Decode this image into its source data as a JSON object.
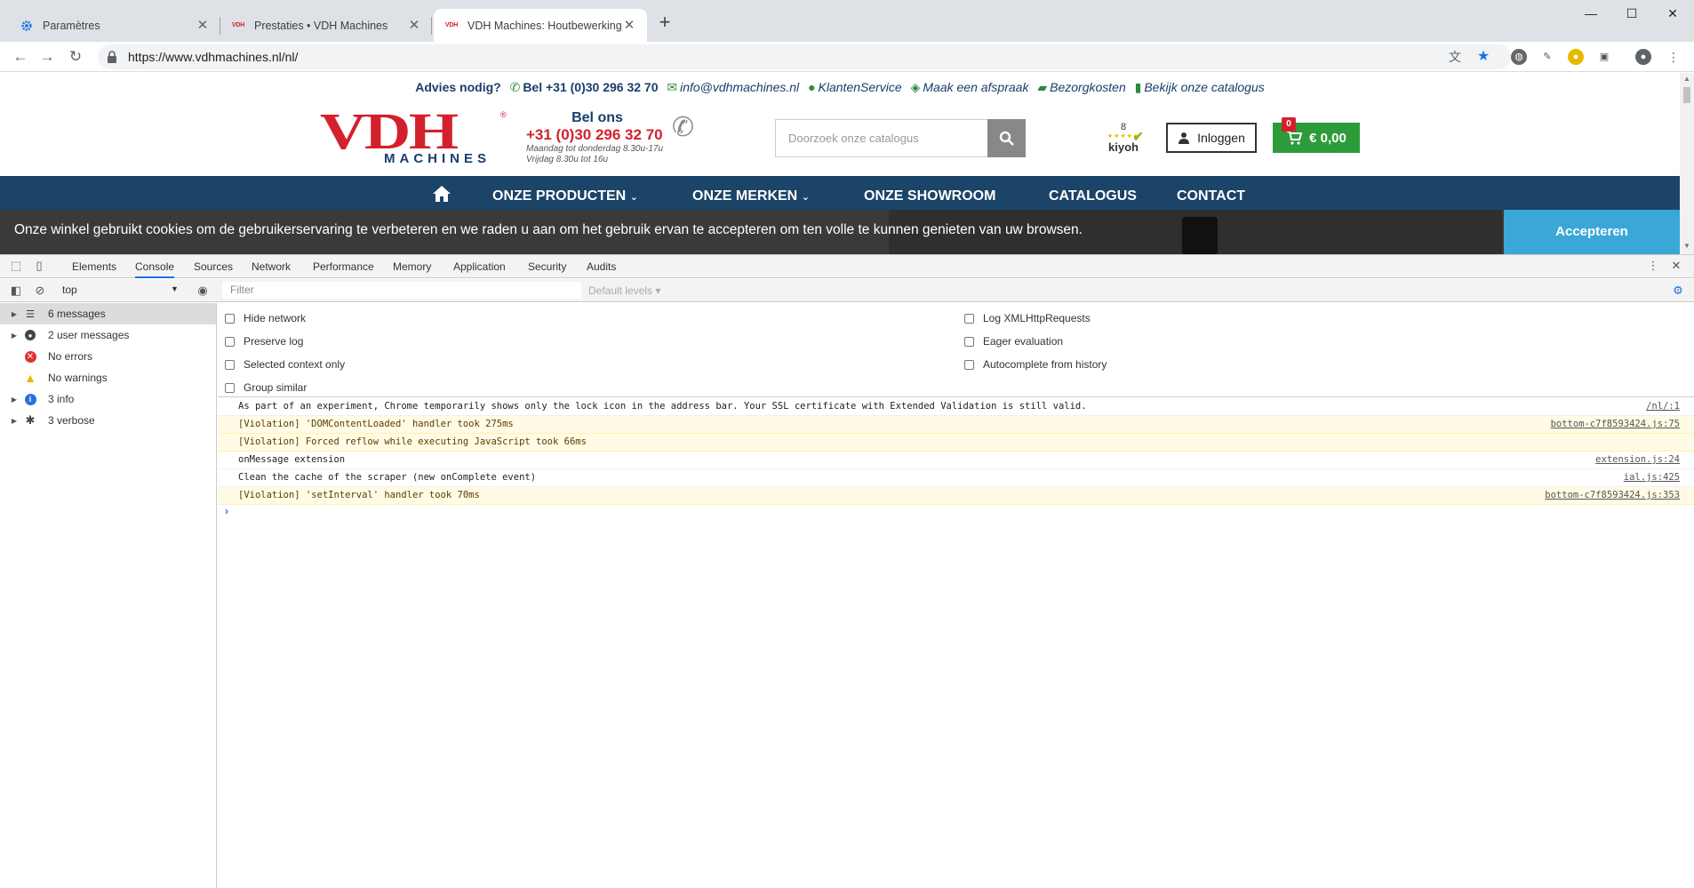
{
  "browser": {
    "tabs": [
      {
        "title": "Paramètres",
        "favicon": "gear-icon",
        "active": false
      },
      {
        "title": "Prestaties • VDH Machines",
        "favicon": "vdh-favicon",
        "active": false
      },
      {
        "title": "VDH Machines: Houtbewerking, ",
        "favicon": "vdh-favicon",
        "active": true
      }
    ],
    "favicon_text": "VDH",
    "tab_close": "✕",
    "new_tab": "+",
    "window_controls": {
      "minimize": "—",
      "maximize": "☐",
      "close": "✕"
    },
    "url": "https://www.vdhmachines.nl/nl/"
  },
  "page": {
    "topline": {
      "advies": "Advies nodig?",
      "bel": "Bel +31 (0)30 296 32 70",
      "email": "info@vdhmachines.nl",
      "klantenservice": "KlantenService",
      "afspraak": "Maak een afspraak",
      "bezorgkosten": "Bezorgkosten",
      "catalogus": "Bekijk onze catalogus"
    },
    "logo": {
      "main": "VDH",
      "sub": "MACHINES",
      "reg": "®"
    },
    "call": {
      "heading": "Bel ons",
      "number": "+31 (0)30 296 32 70",
      "hours1": "Maandag tot donderdag 8.30u-17u",
      "hours2": "Vrijdag 8.30u tot 16u"
    },
    "search_placeholder": "Doorzoek onze catalogus",
    "kiyoh": {
      "score": "8",
      "name": "kiyoh"
    },
    "login_label": "Inloggen",
    "cart": {
      "badge": "0",
      "amount": "€  0,00"
    },
    "nav": [
      "ONZE PRODUCTEN",
      "ONZE MERKEN",
      "ONZE SHOWROOM",
      "CATALOGUS",
      "CONTACT"
    ],
    "cookie_text": "Onze winkel gebruikt cookies om de gebruikerservaring te verbeteren en we raden u aan om het gebruik ervan te accepteren om ten volle te kunnen genieten van uw browsen.",
    "accept_label": "Accepteren"
  },
  "devtools": {
    "tabs": [
      "Elements",
      "Console",
      "Sources",
      "Network",
      "Performance",
      "Memory",
      "Application",
      "Security",
      "Audits"
    ],
    "active_tab": "Console",
    "context": "top",
    "filter_placeholder": "Filter",
    "levels": "Default levels ▾",
    "sidebar": [
      {
        "label": "6 messages",
        "icon": "list-icon",
        "expandable": true,
        "selected": true
      },
      {
        "label": "2 user messages",
        "icon": "user-icon",
        "expandable": true,
        "selected": false
      },
      {
        "label": "No errors",
        "icon": "error-icon",
        "expandable": false,
        "selected": false
      },
      {
        "label": "No warnings",
        "icon": "warning-icon",
        "expandable": false,
        "selected": false
      },
      {
        "label": "3 info",
        "icon": "info-icon",
        "expandable": true,
        "selected": false
      },
      {
        "label": "3 verbose",
        "icon": "verbose-icon",
        "expandable": true,
        "selected": false
      }
    ],
    "settings_left": [
      "Hide network",
      "Preserve log",
      "Selected context only",
      "Group similar"
    ],
    "settings_right": [
      "Log XMLHttpRequests",
      "Eager evaluation",
      "Autocomplete from history"
    ],
    "messages": [
      {
        "text": "As part of an experiment, Chrome temporarily shows only the lock icon in the address bar. Your SSL certificate with Extended Validation is still valid.",
        "source": "/nl/:1",
        "violation": false
      },
      {
        "text": "[Violation] 'DOMContentLoaded' handler took 275ms",
        "source": "bottom-c7f8593424.js:75",
        "violation": true
      },
      {
        "text": "[Violation] Forced reflow while executing JavaScript took 66ms",
        "source": "",
        "violation": true
      },
      {
        "text": "onMessage extension",
        "source": "extension.js:24",
        "violation": false
      },
      {
        "text": "Clean the cache of the scraper (new onComplete event)",
        "source": "ial.js:425",
        "violation": false
      },
      {
        "text": "[Violation] 'setInterval' handler took 70ms",
        "source": "bottom-c7f8593424.js:353",
        "violation": true
      }
    ],
    "prompt": "›"
  },
  "colors": {
    "vdh_red": "#d3202d",
    "vdh_navy": "#1b4468",
    "accept_blue": "#3aa7d6",
    "cart_green": "#2e9b3a"
  }
}
